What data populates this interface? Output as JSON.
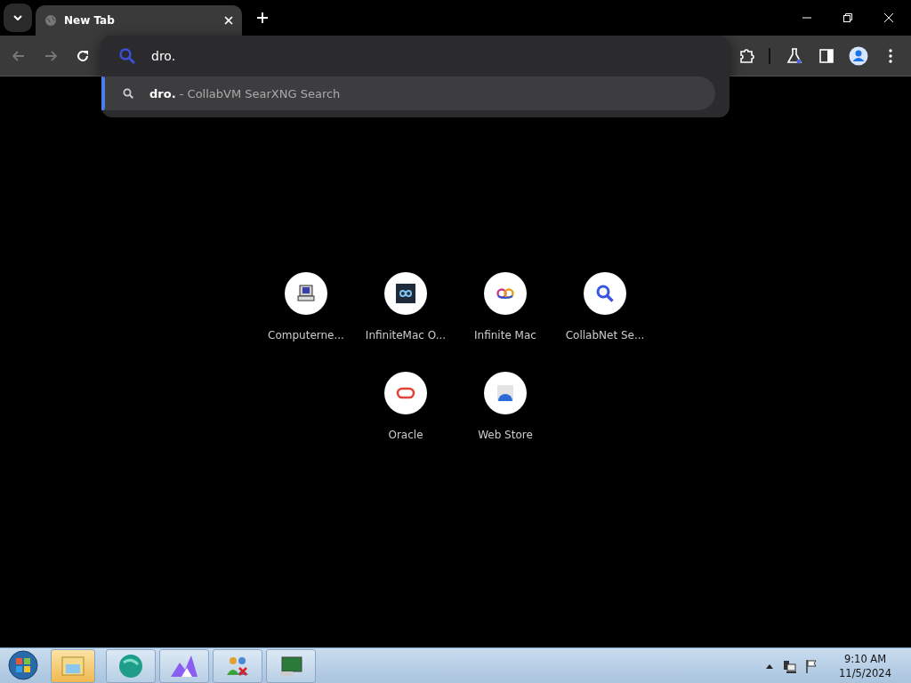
{
  "tabs": [
    {
      "title": "New Tab",
      "selected": true
    }
  ],
  "omnibox": {
    "value": "dro."
  },
  "suggestions": [
    {
      "query": "dro.",
      "provider": "- CollabVM SearXNG Search",
      "selected": true
    }
  ],
  "shortcuts": [
    {
      "title": "Computerne..."
    },
    {
      "title": "InfiniteMac O..."
    },
    {
      "title": "Infinite Mac"
    },
    {
      "title": "CollabNet Se..."
    },
    {
      "title": "Oracle"
    },
    {
      "title": "Web Store"
    }
  ],
  "clock": {
    "time": "9:10 AM",
    "date": "11/5/2024"
  }
}
